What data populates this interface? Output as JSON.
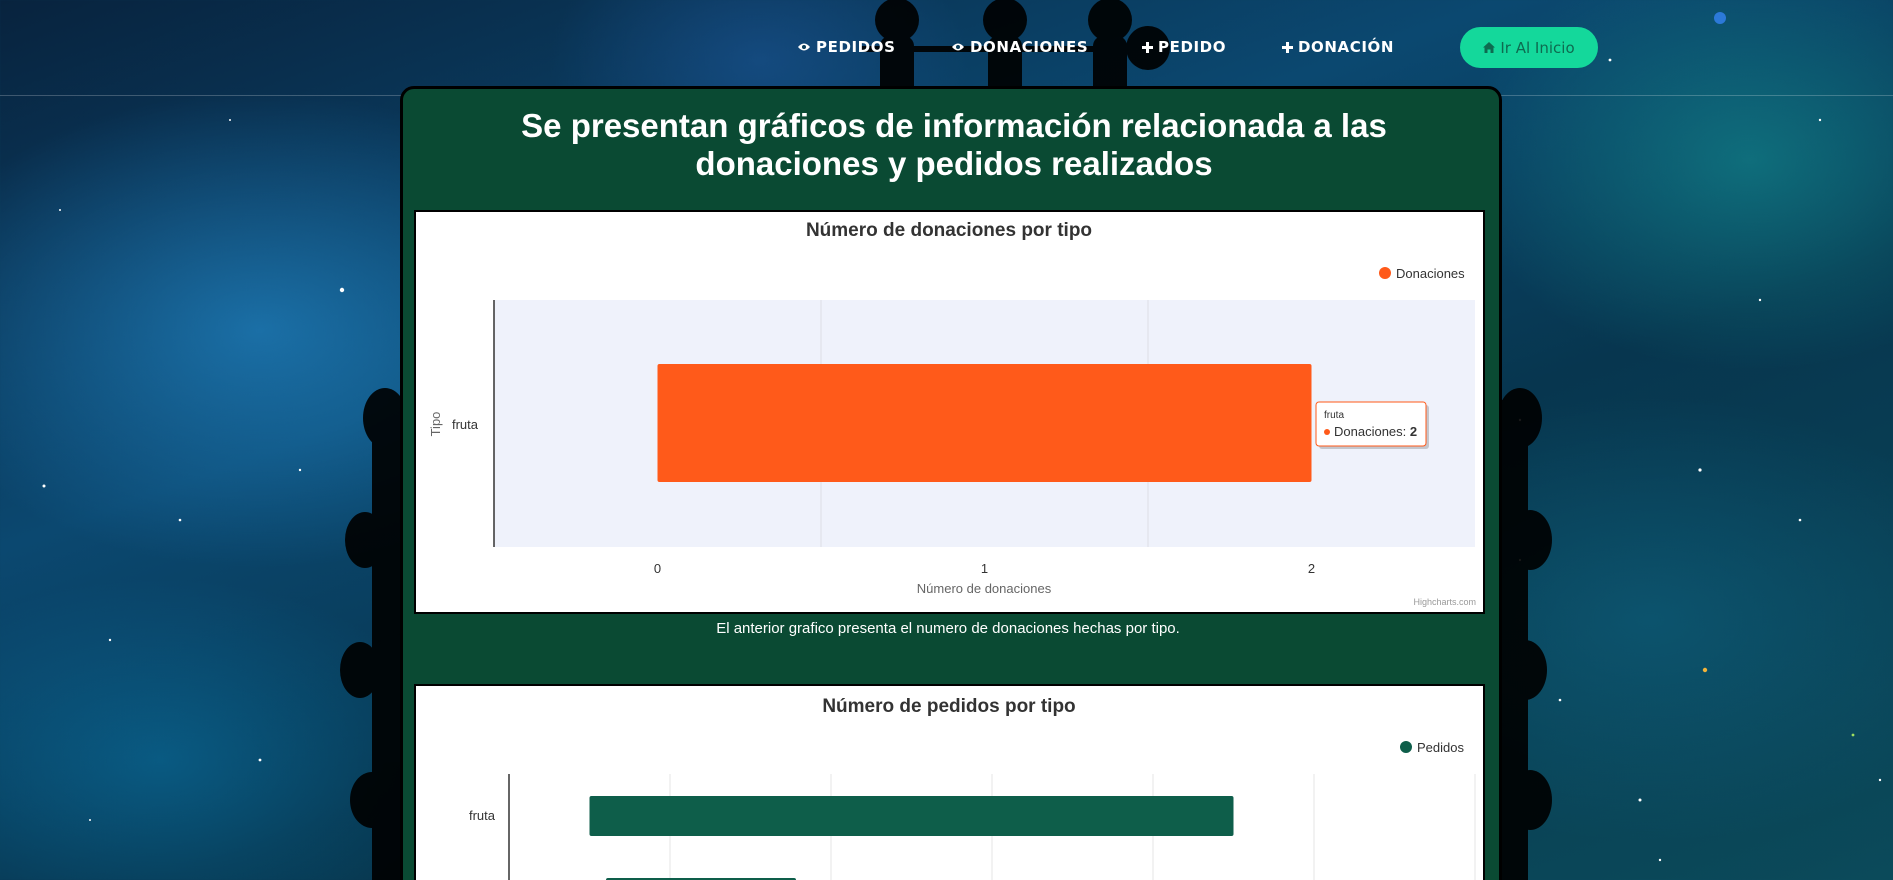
{
  "nav": {
    "items": [
      {
        "label": "PEDIDOS",
        "icon": "eye-icon"
      },
      {
        "label": "DONACIONES",
        "icon": "eye-icon"
      },
      {
        "label": "PEDIDO",
        "icon": "plus-icon"
      },
      {
        "label": "DONACIÓN",
        "icon": "plus-icon"
      }
    ],
    "home_button": {
      "label": "Ir Al Inicio",
      "icon": "home-icon"
    }
  },
  "page": {
    "title": "Se presentan gráficos de información relacionada a las donaciones y pedidos realizados"
  },
  "colors": {
    "accent": "#14d89b",
    "card": "#0a4a33",
    "donaciones": "#ff5a1a",
    "pedidos": "#0e5e4a"
  },
  "chart_data": [
    {
      "type": "bar",
      "orientation": "horizontal",
      "title": "Número de donaciones por tipo",
      "xlabel": "Número de donaciones",
      "ylabel": "Tipo",
      "categories": [
        "fruta"
      ],
      "series": [
        {
          "name": "Donaciones",
          "color": "#ff5a1a",
          "values": [
            2
          ]
        }
      ],
      "xlim": [
        -0.5,
        2.5
      ],
      "ticks": [
        0,
        1,
        2
      ],
      "grid": true,
      "legend": "top-right",
      "tooltip": {
        "category": "fruta",
        "series": "Donaciones",
        "value": "2"
      },
      "credits": "Highcharts.com",
      "caption": "El anterior grafico presenta el numero de donaciones hechas por tipo."
    },
    {
      "type": "bar",
      "orientation": "horizontal",
      "title": "Número de pedidos por tipo",
      "categories": [
        "fruta"
      ],
      "series": [
        {
          "name": "Pedidos",
          "color": "#0e5e4a",
          "values": [
            4
          ]
        }
      ],
      "legend": "top-right"
    }
  ]
}
